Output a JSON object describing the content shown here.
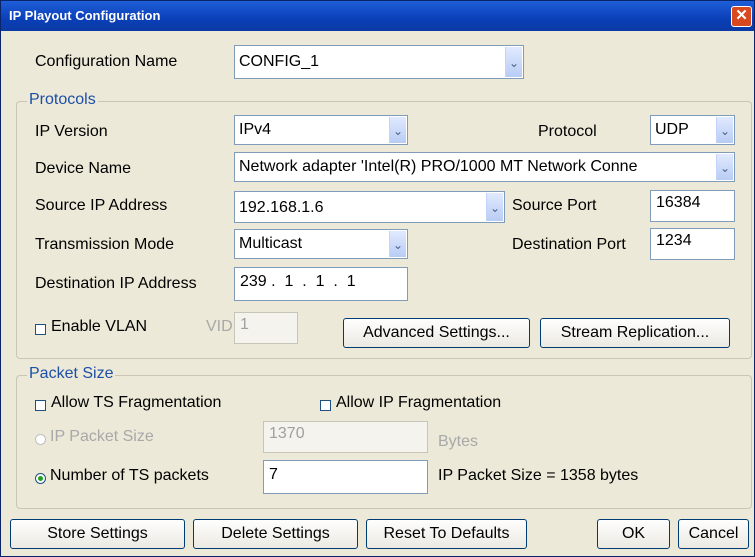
{
  "window": {
    "title": "IP Playout Configuration",
    "close_glyph": "✕"
  },
  "config": {
    "label": "Configuration Name",
    "value": "CONFIG_1"
  },
  "protocols": {
    "group_label": "Protocols",
    "ip_version": {
      "label": "IP Version",
      "value": "IPv4"
    },
    "protocol": {
      "label": "Protocol",
      "value": "UDP"
    },
    "device_name": {
      "label": "Device Name",
      "value": "Network adapter 'Intel(R) PRO/1000 MT Network Conne"
    },
    "source_ip": {
      "label": "Source IP Address",
      "value": "192.168.1.6"
    },
    "source_port": {
      "label": "Source Port",
      "value": "16384"
    },
    "transmission_mode": {
      "label": "Transmission Mode",
      "value": "Multicast"
    },
    "destination_port": {
      "label": "Destination Port",
      "value": "1234"
    },
    "destination_ip": {
      "label": "Destination IP Address",
      "value": "239 .  1  .  1  .  1"
    },
    "enable_vlan": {
      "label": "Enable VLAN",
      "checked": false
    },
    "vid": {
      "label": "VID",
      "value": "1"
    },
    "advanced_button": "Advanced Settings...",
    "replication_button": "Stream Replication..."
  },
  "packet_size": {
    "group_label": "Packet Size",
    "allow_ts_frag": {
      "label": "Allow TS Fragmentation",
      "checked": false
    },
    "allow_ip_frag": {
      "label": "Allow IP Fragmentation",
      "checked": false
    },
    "ip_packet_size": {
      "label": "IP Packet Size",
      "value": "1370",
      "unit": "Bytes",
      "selected": false,
      "enabled": false
    },
    "num_ts_packets": {
      "label": "Number of TS packets",
      "value": "7",
      "selected": true
    },
    "computed_label": "IP Packet Size =  1358 bytes"
  },
  "buttons": {
    "store": "Store Settings",
    "delete": "Delete Settings",
    "reset": "Reset To Defaults",
    "ok": "OK",
    "cancel": "Cancel"
  },
  "icons": {
    "dropdown": "chevron-down-icon",
    "close": "close-icon"
  }
}
